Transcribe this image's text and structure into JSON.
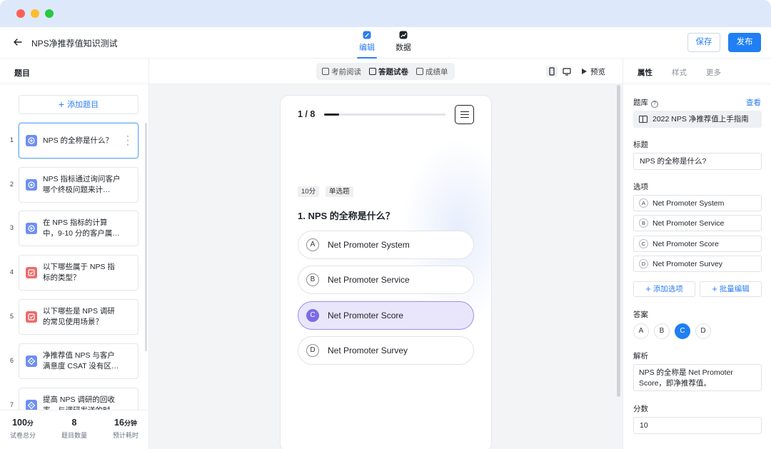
{
  "window": {
    "controls": [
      "close",
      "minimize",
      "maximize"
    ]
  },
  "header": {
    "title": "NPS净推荐值知识测试",
    "tabs": [
      {
        "label": "编辑",
        "icon": "edit-icon",
        "active": true
      },
      {
        "label": "数据",
        "icon": "chart-icon",
        "active": false
      }
    ],
    "save_label": "保存",
    "publish_label": "发布"
  },
  "left_panel": {
    "title": "题目",
    "add_label": "添加题目",
    "questions": [
      {
        "num": "1",
        "text": "NPS 的全称是什么？",
        "type": "single",
        "selected": true
      },
      {
        "num": "2",
        "text": "NPS 指标通过询问客户哪个终极问题来计…",
        "type": "single",
        "selected": false
      },
      {
        "num": "3",
        "text": "在 NPS 指标的计算中，9-10 分的客户属…",
        "type": "single",
        "selected": false
      },
      {
        "num": "4",
        "text": "以下哪些属于 NPS 指标的类型？",
        "type": "multi",
        "selected": false
      },
      {
        "num": "5",
        "text": "以下哪些是 NPS 调研的常见使用场景？",
        "type": "multi",
        "selected": false
      },
      {
        "num": "6",
        "text": "净推荐值 NPS 与客户满意度 CSAT 没有区…",
        "type": "judge",
        "selected": false
      },
      {
        "num": "7",
        "text": "提高 NPS 调研的回收率，与调研发送的时…",
        "type": "judge",
        "selected": false
      }
    ],
    "stats": [
      {
        "value": "100",
        "unit": "分",
        "label": "试卷总分"
      },
      {
        "value": "8",
        "unit": "",
        "label": "题目数量"
      },
      {
        "value": "16",
        "unit": "分钟",
        "label": "预计耗时"
      }
    ]
  },
  "center": {
    "segments": [
      {
        "label": "考前阅读",
        "active": false
      },
      {
        "label": "答题试卷",
        "active": true
      },
      {
        "label": "成绩单",
        "active": false
      }
    ],
    "preview_label": "预览",
    "progress_text": "1 / 8",
    "progress_fraction": 0.125,
    "tags": [
      "10分",
      "单选题"
    ],
    "question_title": "1. NPS 的全称是什么？",
    "options": [
      {
        "key": "A",
        "text": "Net Promoter System",
        "selected": false
      },
      {
        "key": "B",
        "text": "Net Promoter Service",
        "selected": false
      },
      {
        "key": "C",
        "text": "Net Promoter Score",
        "selected": true
      },
      {
        "key": "D",
        "text": "Net Promoter Survey",
        "selected": false
      }
    ]
  },
  "right_panel": {
    "tabs": [
      {
        "label": "属性",
        "active": true
      },
      {
        "label": "样式",
        "active": false
      },
      {
        "label": "更多",
        "active": false
      }
    ],
    "bank_label": "题库",
    "bank_link": "查看",
    "bank_value": "2022 NPS 净推荐值上手指南",
    "title_label": "标题",
    "title_value": "NPS 的全称是什么?",
    "options_label": "选项",
    "options": [
      {
        "key": "A",
        "text": "Net Promoter System"
      },
      {
        "key": "B",
        "text": "Net Promoter Service"
      },
      {
        "key": "C",
        "text": "Net Promoter Score"
      },
      {
        "key": "D",
        "text": "Net Promoter Survey"
      }
    ],
    "add_option_label": "添加选项",
    "batch_edit_label": "批量编辑",
    "answer_label": "答案",
    "answers": [
      {
        "key": "A",
        "selected": false
      },
      {
        "key": "B",
        "selected": false
      },
      {
        "key": "C",
        "selected": true
      },
      {
        "key": "D",
        "selected": false
      }
    ],
    "explain_label": "解析",
    "explain_value": "NPS 的全称是 Net Promoter Score，即净推荐值。",
    "score_label": "分数",
    "score_value": "10"
  },
  "colors": {
    "primary": "#1f7ff3",
    "selected_option": "#e9e6fb",
    "selected_badge": "#7c6ae6"
  }
}
